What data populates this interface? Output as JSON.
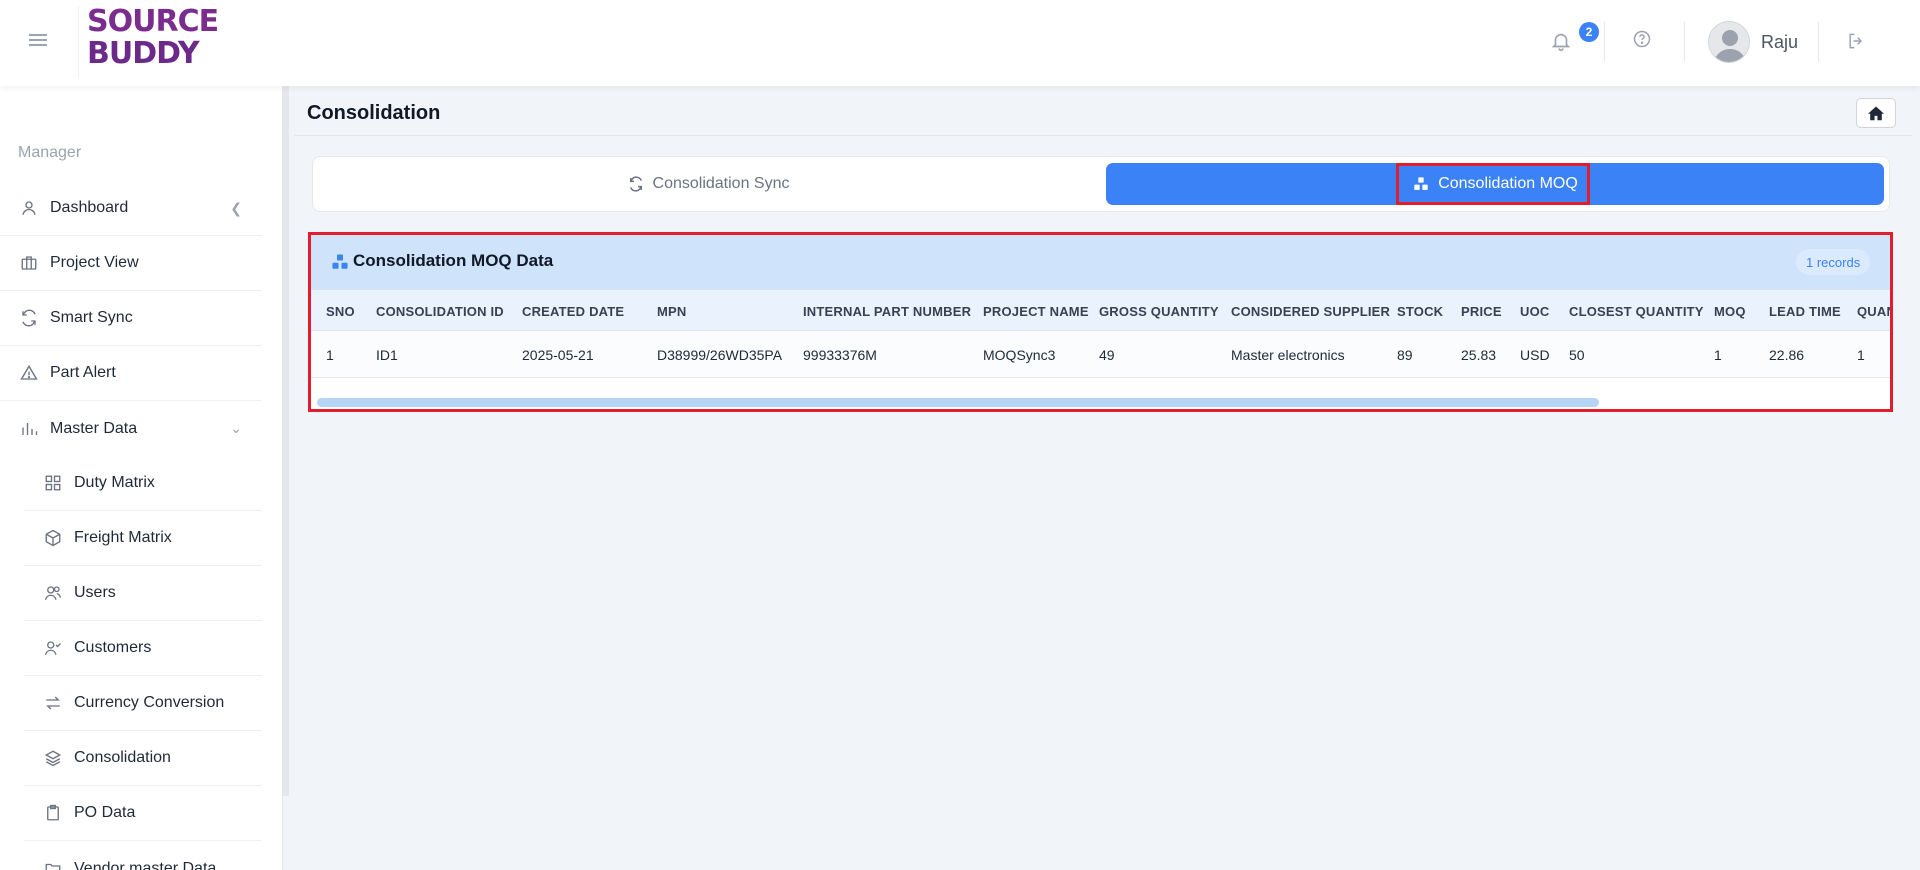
{
  "header": {
    "logo": {
      "line1": "SOURCE",
      "line2": "BUDDY"
    },
    "notifications_count": "2",
    "user_name": "Raju"
  },
  "sidebar": {
    "section_label": "Manager",
    "items": [
      {
        "label": "Dashboard",
        "icon": "user-icon"
      },
      {
        "label": "Project View",
        "icon": "briefcase-icon"
      },
      {
        "label": "Smart Sync",
        "icon": "sync-icon"
      },
      {
        "label": "Part Alert",
        "icon": "warning-icon"
      },
      {
        "label": "Master Data",
        "icon": "bar-chart-icon"
      }
    ],
    "sub_items": [
      {
        "label": "Duty Matrix",
        "icon": "grid-icon"
      },
      {
        "label": "Freight Matrix",
        "icon": "box-icon"
      },
      {
        "label": "Users",
        "icon": "users-icon"
      },
      {
        "label": "Customers",
        "icon": "user-check-icon"
      },
      {
        "label": "Currency Conversion",
        "icon": "swap-icon"
      },
      {
        "label": "Consolidation",
        "icon": "layers-icon"
      },
      {
        "label": "PO Data",
        "icon": "clipboard-icon"
      },
      {
        "label": "Vendor master Data",
        "icon": "folder-icon"
      }
    ]
  },
  "page": {
    "title": "Consolidation",
    "tabs": [
      {
        "label": "Consolidation Sync",
        "active": false
      },
      {
        "label": "Consolidation MOQ",
        "active": true
      }
    ]
  },
  "table": {
    "title": "Consolidation MOQ Data",
    "records_badge": "1 records",
    "columns": [
      "SNO",
      "CONSOLIDATION ID",
      "CREATED DATE",
      "MPN",
      "INTERNAL PART NUMBER",
      "PROJECT NAME",
      "GROSS QUANTITY",
      "CONSIDERED SUPPLIER",
      "STOCK",
      "PRICE",
      "UOC",
      "CLOSEST QUANTITY",
      "MOQ",
      "LEAD TIME",
      "QUAN"
    ],
    "rows": [
      [
        "1",
        "ID1",
        "2025-05-21",
        "D38999/26WD35PA",
        "99933376M",
        "MOQSync3",
        "49",
        "Master electronics",
        "89",
        "25.83",
        "USD",
        "50",
        "1",
        "22.86",
        "1"
      ]
    ]
  },
  "colors": {
    "accent": "#3b82f6",
    "highlight": "#e11d2e",
    "table_header": "#cfe3fb"
  }
}
